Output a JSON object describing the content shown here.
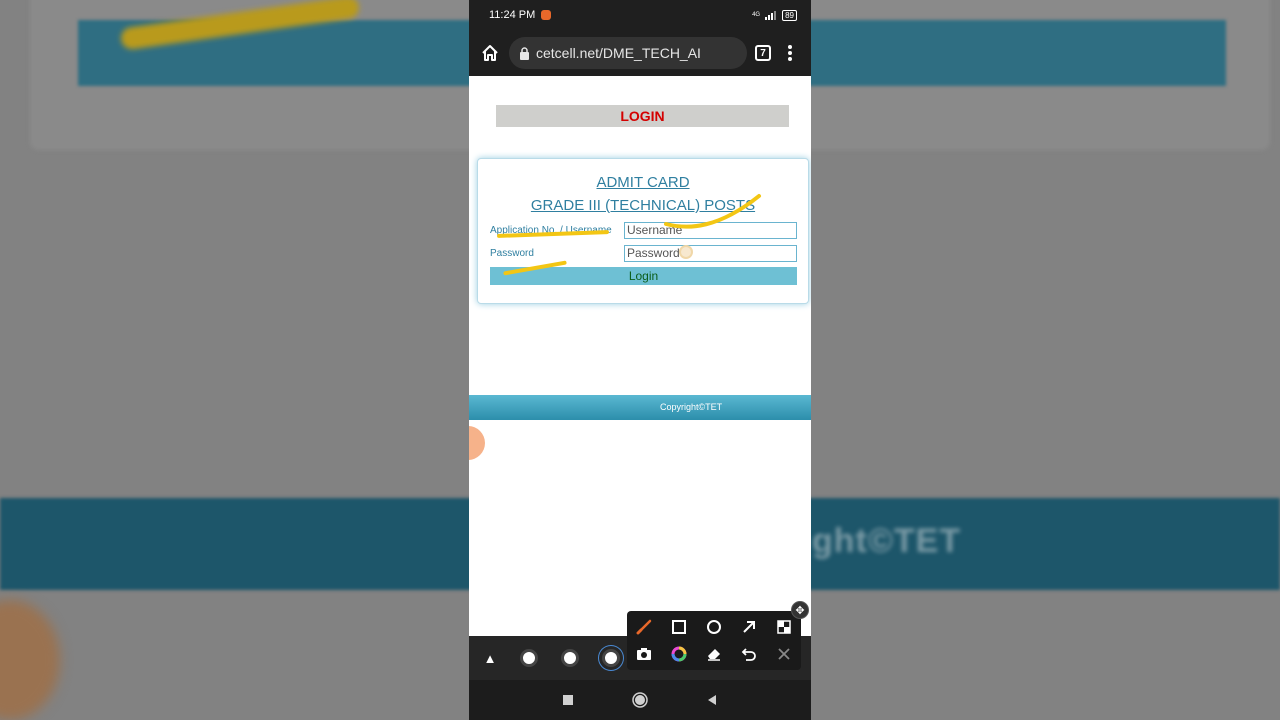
{
  "background": {
    "footer_text": "Copyright©TET"
  },
  "statusbar": {
    "time": "11:24 PM",
    "network": "4G",
    "battery": "89"
  },
  "browser": {
    "url": "cetcell.net/DME_TECH_AI",
    "tab_count": "7"
  },
  "page": {
    "login_heading": "LOGIN",
    "card_title_1": "ADMIT CARD",
    "card_title_2": "GRADE III (TECHNICAL) POSTS",
    "username_label": "Application No. / Username",
    "username_placeholder": "Username",
    "password_label": "Password",
    "password_placeholder": "Password",
    "login_button": "Login",
    "footer": "Copyright©TET"
  },
  "colors": {
    "heading_red": "#d40000",
    "link_blue": "#2f7fa0",
    "button_teal": "#6ec0d4",
    "highlight_yellow": "#f3c614"
  },
  "icons": {
    "home": "home-icon",
    "lock": "lock-icon",
    "menu": "kebab-menu-icon",
    "brush": "brush-icon",
    "square": "square-icon",
    "circle": "circle-icon",
    "arrow": "arrow-icon",
    "mosaic": "mosaic-icon",
    "camera": "camera-icon",
    "color": "color-wheel-icon",
    "eraser": "eraser-icon",
    "undo": "undo-icon",
    "close": "close-icon"
  }
}
